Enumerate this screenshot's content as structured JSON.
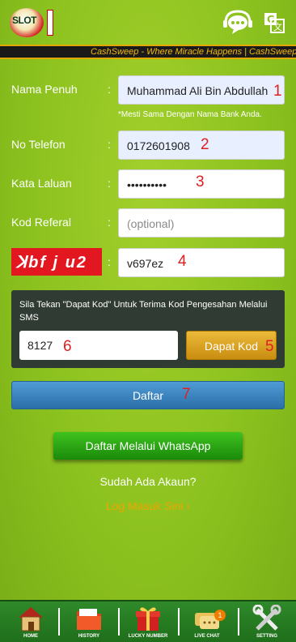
{
  "header": {
    "logo_text": "SLOT",
    "icons": [
      "live-chat-icon",
      "translate-icon"
    ]
  },
  "marquee": {
    "text": "CashSweep - Where Miracle Happens | CashSweep"
  },
  "form": {
    "full_name": {
      "label": "Nama Penuh",
      "value": "Muhammad Ali Bin Abdullah",
      "marker": "1"
    },
    "hint": "*Mesti Sama Dengan Nama Bank Anda.",
    "phone": {
      "label": "No Telefon",
      "value": "0172601908",
      "marker": "2"
    },
    "password": {
      "label": "Kata Laluan",
      "value": "••••••••••",
      "marker": "3"
    },
    "referral": {
      "label": "Kod Referal",
      "placeholder": "(optional)"
    },
    "captcha": {
      "image_text": "ꓘbf j u2",
      "value": "v697ez",
      "marker": "4"
    },
    "colon": ":"
  },
  "sms": {
    "instruction": "Sila Tekan \"Dapat Kod\" Untuk Terima Kod Pengesahan Melalui SMS",
    "code_value": "8127",
    "code_marker": "6",
    "button_label": "Dapat Kod",
    "button_marker": "5"
  },
  "actions": {
    "register_label": "Daftar",
    "register_marker": "7",
    "whatsapp_label": "Daftar Melalui WhatsApp",
    "have_account": "Sudah Ada Akaun?",
    "login_link": "Log Masuk Sini"
  },
  "bottom_nav": {
    "home": "HOME",
    "history": "HISTORY",
    "lucky": "LUCKY NUMBER",
    "chat": "LIVE CHAT",
    "chat_badge": "1",
    "setting": "SETTING"
  },
  "colors": {
    "background": "#8cc21f",
    "register_button": "#2c6fa8",
    "whatsapp_button": "#1a8a0a",
    "get_code_button": "#c98d10",
    "login_link": "#f0a400",
    "annotation": "#e02020"
  }
}
